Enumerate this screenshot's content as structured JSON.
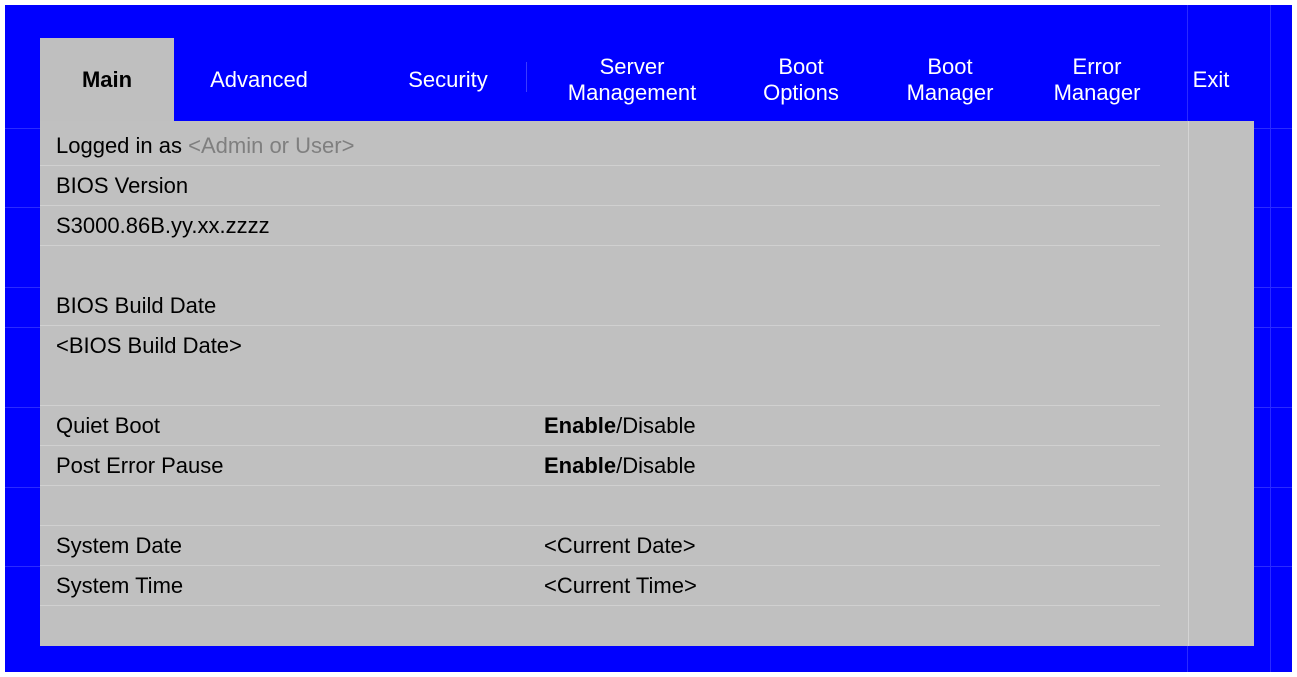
{
  "tabs": [
    {
      "label": "Main",
      "active": true
    },
    {
      "label": "Advanced",
      "active": false
    },
    {
      "label": "Security",
      "active": false
    },
    {
      "label": "Server\nManagement",
      "active": false
    },
    {
      "label": "Boot\nOptions",
      "active": false
    },
    {
      "label": "Boot\nManager",
      "active": false
    },
    {
      "label": "Error\nManager",
      "active": false
    },
    {
      "label": "Exit",
      "active": false
    }
  ],
  "main": {
    "logged_in_label": "Logged in as",
    "logged_in_value": "<Admin or User>",
    "bios_version_label": "BIOS Version",
    "bios_version_value": "S3000.86B.yy.xx.zzzz",
    "bios_build_date_label": "BIOS Build Date",
    "bios_build_date_value": "<BIOS Build Date>",
    "quiet_boot": {
      "label": "Quiet Boot",
      "selected": "Enable",
      "separator": "/",
      "other": "Disable"
    },
    "post_error_pause": {
      "label": "Post Error Pause",
      "selected": "Enable",
      "separator": "/",
      "other": "Disable"
    },
    "system_date": {
      "label": "System Date",
      "value": "<Current Date>"
    },
    "system_time": {
      "label": "System Time",
      "value": "<Current Time>"
    }
  },
  "colors": {
    "background": "#0000ff",
    "panel": "#c0c0c0",
    "active_tab": "#bfbfbf",
    "disabled_text": "#7f7f7f"
  }
}
